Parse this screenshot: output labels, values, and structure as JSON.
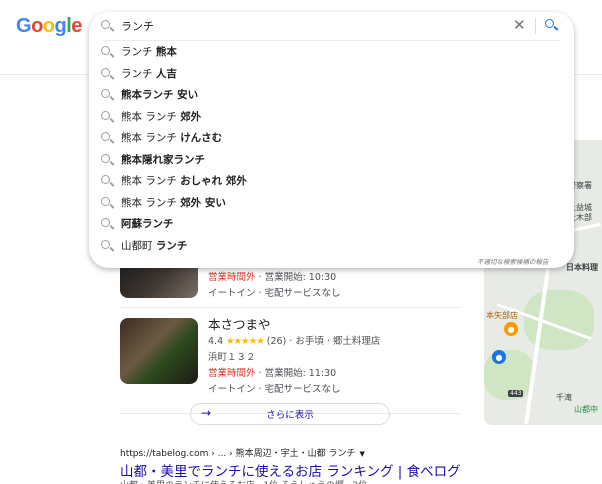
{
  "logo": [
    "G",
    "o",
    "o",
    "g",
    "l",
    "e"
  ],
  "search": {
    "query": "ランチ",
    "suggestions": [
      {
        "prefix": "ランチ ",
        "completion": "熊本"
      },
      {
        "prefix": "ランチ ",
        "completion": "人吉"
      },
      {
        "prefix": "",
        "completion": "熊本ランチ 安い"
      },
      {
        "prefix": "熊本 ランチ ",
        "completion": "郊外"
      },
      {
        "prefix": "熊本 ランチ ",
        "completion": "けんさむ"
      },
      {
        "prefix": "",
        "completion": "熊本隠れ家ランチ"
      },
      {
        "prefix": "熊本 ランチ ",
        "completion": "おしゃれ 郊外"
      },
      {
        "prefix": "熊本 ランチ ",
        "completion": "郊外 安い"
      },
      {
        "prefix": "",
        "completion": "阿蘇ランチ"
      },
      {
        "prefix": "山都町 ",
        "completion": "ランチ"
      }
    ],
    "report_link": "不適切な検索候補の報告"
  },
  "results": {
    "card1": {
      "hours_status": "営業時間外",
      "hours_open": " · 営業開始: 10:30",
      "services": "イートイン · 宅配サービスなし"
    },
    "card2": {
      "title": "本さつまや",
      "rating": "4.4",
      "stars": "★★★★★",
      "reviews": "(26) · お手頃 · 郷土料理店",
      "address": "浜町１３２",
      "hours_status": "営業時間外",
      "hours_open": " · 営業開始: 11:30",
      "services": "イートイン · 宅配サービスなし"
    },
    "more_button": "さらに表示",
    "web_result": {
      "breadcrumb": "https://tabelog.com › ... › 熊本周辺・宇土・山都 ランチ",
      "title": "山都・美里でランチに使えるお店 ランキング | 食べログ",
      "snippet": "山都・美里のランチに使えるお店 · 1位 そうしゅうの郷 · 2位 ..."
    }
  },
  "map": {
    "labels": [
      "警察署",
      "上益城",
      "土木部",
      "日本料理",
      "本矢部店",
      "443",
      "千滝",
      "山都中"
    ]
  }
}
